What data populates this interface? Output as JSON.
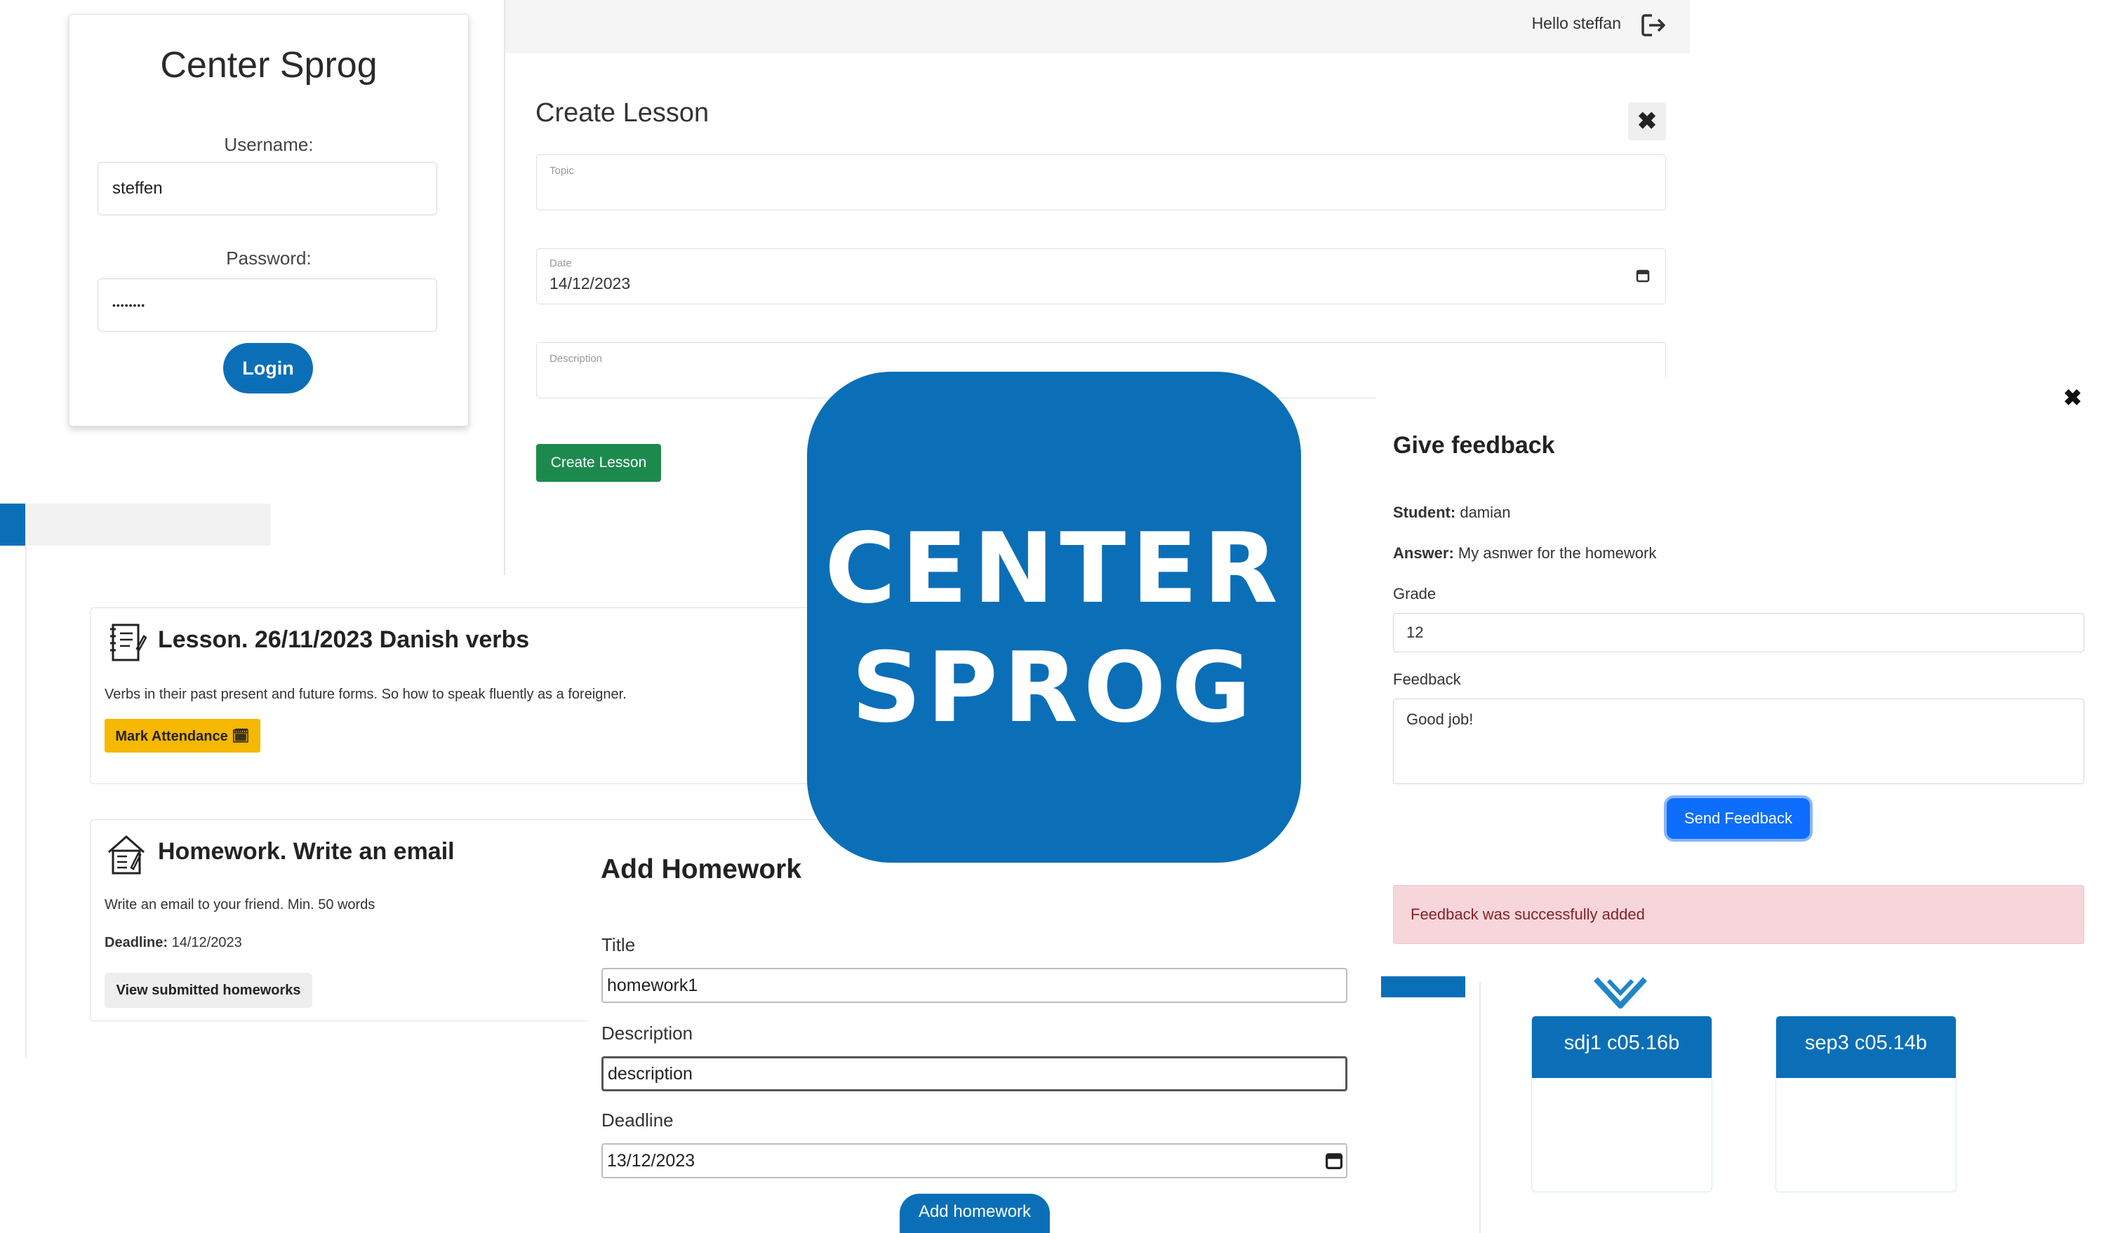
{
  "login": {
    "title": "Center Sprog",
    "username_label": "Username:",
    "username_value": "steffen",
    "password_label": "Password:",
    "password_value": "••••••••",
    "login_button": "Login"
  },
  "header": {
    "greeting": "Hello steffan",
    "logout_icon": "logout-icon"
  },
  "create_lesson": {
    "title": "Create Lesson",
    "close_label": "✖",
    "topic_label": "Topic",
    "topic_value": "",
    "date_label": "Date",
    "date_value": "14/12/2023",
    "description_label": "Description",
    "description_value": "",
    "submit_button": "Create Lesson"
  },
  "lesson_card": {
    "title": "Lesson. 26/11/2023 Danish verbs",
    "description": "Verbs in their past present and future forms. So how to speak fluently as a foreigner.",
    "mark_attendance_button": "Mark Attendance 🗓"
  },
  "homework_card": {
    "title": "Homework. Write an email",
    "description": "Write an email to your friend. Min. 50 words",
    "deadline_label": "Deadline:",
    "deadline_value": "14/12/2023",
    "view_button": "View submitted homeworks"
  },
  "add_homework": {
    "title": "Add Homework",
    "title_label": "Title",
    "title_value": "homework1",
    "description_label": "Description",
    "description_value": "description",
    "deadline_label": "Deadline",
    "deadline_value": "13/12/2023",
    "submit_button": "Add homework"
  },
  "logo": {
    "line1": "CENTER",
    "line2": "SPROG"
  },
  "feedback": {
    "close_label": "✖",
    "title": "Give feedback",
    "student_label": "Student:",
    "student_value": "damian",
    "answer_label": "Answer:",
    "answer_value": "My asnwer for the homework",
    "grade_label": "Grade",
    "grade_value": "12",
    "feedback_label": "Feedback",
    "feedback_value": "Good job!",
    "send_button": "Send Feedback",
    "success_message": "Feedback was successfully added"
  },
  "classes": [
    {
      "name": "sdj1 c05.16b"
    },
    {
      "name": "sep3 c05.14b"
    }
  ],
  "colors": {
    "brand_blue": "#0b6fb7",
    "success_green": "#1d8a4d",
    "attendance_yellow": "#f6b800",
    "primary_button": "#0d6efd",
    "alert_bg": "#f6d6da"
  }
}
